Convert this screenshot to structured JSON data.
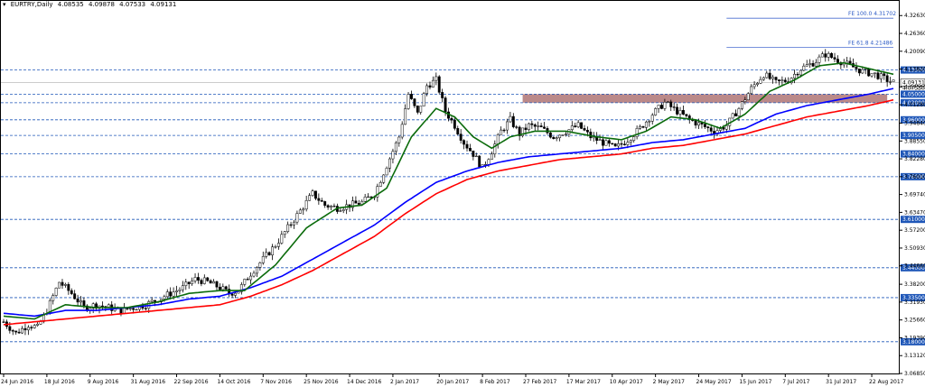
{
  "header": {
    "symbol": "EURTRY,Daily",
    "open": "4.08535",
    "high": "4.09878",
    "low": "4.07533",
    "close": "4.09131"
  },
  "colors": {
    "background": "#ffffff",
    "candle": "#000000",
    "ma_fast": "#0b6b0b",
    "ma_mid": "#0000ff",
    "ma_slow": "#ff0000",
    "level_line": "#1f57b8",
    "level_badge": "#1f57b8",
    "zone": "#b47c7c",
    "price_badge": "#ffffff"
  },
  "chart_data": {
    "type": "candlestick",
    "symbol": "EURTRY",
    "timeframe": "Daily",
    "ylim": [
      3.0685,
      4.3683
    ],
    "y_ticks": [
      "4.32630",
      "4.26360",
      "4.20090",
      "4.13820",
      "4.07550",
      "4.01280",
      "3.94840",
      "3.88550",
      "3.82280",
      "3.76010",
      "3.69740",
      "3.63470",
      "3.57200",
      "3.50930",
      "3.44660",
      "3.38200",
      "3.31930",
      "3.25660",
      "3.19390",
      "3.13120",
      "3.06850"
    ],
    "x_ticks": [
      "24 Jun 2016",
      "18 Jul 2016",
      "9 Aug 2016",
      "31 Aug 2016",
      "22 Sep 2016",
      "14 Oct 2016",
      "7 Nov 2016",
      "25 Nov 2016",
      "14 Dec 2016",
      "2 Jan 2017",
      "20 Jan 2017",
      "8 Feb 2017",
      "27 Feb 2017",
      "17 Mar 2017",
      "10 Apr 2017",
      "2 May 2017",
      "24 May 2017",
      "15 Jun 2017",
      "7 Jul 2017",
      "31 Jul 2017",
      "22 Aug 2017"
    ],
    "horizontal_levels": [
      "4.13500",
      "4.05000",
      "4.02000",
      "3.96000",
      "3.90500",
      "3.84000",
      "3.76000",
      "3.61000",
      "3.44000",
      "3.33500",
      "3.18000"
    ],
    "current_price": "4.09131",
    "current_price_value": 4.09131,
    "extra_price_label": "4.07530",
    "fibonacci": [
      {
        "label": "FE 100.0 4.31702",
        "value": 4.31702
      },
      {
        "label": "FE 61.8 4.21486",
        "value": 4.21486
      }
    ],
    "zone": {
      "from": 4.02,
      "to": 4.05
    },
    "price_path": [
      [
        0,
        3.25
      ],
      [
        4,
        3.21
      ],
      [
        8,
        3.24
      ],
      [
        11,
        3.23
      ],
      [
        14,
        3.29
      ],
      [
        18,
        3.39
      ],
      [
        22,
        3.35
      ],
      [
        26,
        3.3
      ],
      [
        30,
        3.31
      ],
      [
        34,
        3.3
      ],
      [
        38,
        3.29
      ],
      [
        42,
        3.3
      ],
      [
        46,
        3.31
      ],
      [
        50,
        3.33
      ],
      [
        54,
        3.35
      ],
      [
        58,
        3.37
      ],
      [
        62,
        3.4
      ],
      [
        66,
        3.39
      ],
      [
        70,
        3.37
      ],
      [
        73,
        3.35
      ],
      [
        76,
        3.36
      ],
      [
        80,
        3.42
      ],
      [
        84,
        3.47
      ],
      [
        88,
        3.52
      ],
      [
        92,
        3.58
      ],
      [
        96,
        3.64
      ],
      [
        100,
        3.7
      ],
      [
        104,
        3.66
      ],
      [
        108,
        3.65
      ],
      [
        112,
        3.66
      ],
      [
        116,
        3.67
      ],
      [
        120,
        3.7
      ],
      [
        124,
        3.8
      ],
      [
        128,
        3.9
      ],
      [
        131,
        4.05
      ],
      [
        134,
        3.98
      ],
      [
        137,
        4.08
      ],
      [
        140,
        4.1
      ],
      [
        143,
        3.99
      ],
      [
        146,
        3.94
      ],
      [
        149,
        3.88
      ],
      [
        152,
        3.84
      ],
      [
        155,
        3.79
      ],
      [
        158,
        3.85
      ],
      [
        161,
        3.92
      ],
      [
        164,
        3.96
      ],
      [
        167,
        3.91
      ],
      [
        170,
        3.94
      ],
      [
        174,
        3.93
      ],
      [
        178,
        3.9
      ],
      [
        182,
        3.92
      ],
      [
        186,
        3.94
      ],
      [
        190,
        3.9
      ],
      [
        194,
        3.88
      ],
      [
        198,
        3.86
      ],
      [
        202,
        3.89
      ],
      [
        206,
        3.93
      ],
      [
        210,
        3.98
      ],
      [
        214,
        4.02
      ],
      [
        218,
        3.99
      ],
      [
        222,
        3.96
      ],
      [
        226,
        3.94
      ],
      [
        230,
        3.92
      ],
      [
        234,
        3.94
      ],
      [
        238,
        4.0
      ],
      [
        242,
        4.07
      ],
      [
        246,
        4.12
      ],
      [
        250,
        4.09
      ],
      [
        254,
        4.1
      ],
      [
        258,
        4.14
      ],
      [
        262,
        4.16
      ],
      [
        266,
        4.19
      ],
      [
        270,
        4.17
      ],
      [
        274,
        4.15
      ],
      [
        278,
        4.13
      ],
      [
        282,
        4.12
      ],
      [
        286,
        4.1
      ],
      [
        288,
        4.09131
      ]
    ],
    "ma_fast_path": [
      [
        0,
        3.27
      ],
      [
        10,
        3.26
      ],
      [
        20,
        3.31
      ],
      [
        30,
        3.3
      ],
      [
        40,
        3.3
      ],
      [
        50,
        3.32
      ],
      [
        60,
        3.35
      ],
      [
        70,
        3.36
      ],
      [
        78,
        3.36
      ],
      [
        88,
        3.45
      ],
      [
        98,
        3.58
      ],
      [
        108,
        3.65
      ],
      [
        116,
        3.66
      ],
      [
        124,
        3.72
      ],
      [
        132,
        3.9
      ],
      [
        140,
        4.0
      ],
      [
        146,
        3.97
      ],
      [
        152,
        3.9
      ],
      [
        158,
        3.86
      ],
      [
        164,
        3.9
      ],
      [
        172,
        3.92
      ],
      [
        182,
        3.92
      ],
      [
        192,
        3.9
      ],
      [
        200,
        3.89
      ],
      [
        208,
        3.92
      ],
      [
        216,
        3.97
      ],
      [
        224,
        3.96
      ],
      [
        232,
        3.93
      ],
      [
        240,
        3.98
      ],
      [
        248,
        4.06
      ],
      [
        256,
        4.1
      ],
      [
        264,
        4.15
      ],
      [
        272,
        4.16
      ],
      [
        280,
        4.14
      ],
      [
        288,
        4.12
      ]
    ],
    "ma_mid_path": [
      [
        0,
        3.28
      ],
      [
        10,
        3.27
      ],
      [
        20,
        3.29
      ],
      [
        30,
        3.29
      ],
      [
        40,
        3.3
      ],
      [
        50,
        3.31
      ],
      [
        60,
        3.33
      ],
      [
        70,
        3.34
      ],
      [
        80,
        3.37
      ],
      [
        90,
        3.41
      ],
      [
        100,
        3.47
      ],
      [
        110,
        3.53
      ],
      [
        120,
        3.59
      ],
      [
        130,
        3.67
      ],
      [
        140,
        3.74
      ],
      [
        150,
        3.78
      ],
      [
        160,
        3.81
      ],
      [
        170,
        3.83
      ],
      [
        180,
        3.84
      ],
      [
        190,
        3.85
      ],
      [
        200,
        3.86
      ],
      [
        210,
        3.88
      ],
      [
        220,
        3.89
      ],
      [
        230,
        3.91
      ],
      [
        240,
        3.93
      ],
      [
        250,
        3.98
      ],
      [
        260,
        4.01
      ],
      [
        270,
        4.03
      ],
      [
        280,
        4.05
      ],
      [
        288,
        4.07
      ]
    ],
    "ma_slow_path": [
      [
        0,
        3.24
      ],
      [
        10,
        3.25
      ],
      [
        20,
        3.26
      ],
      [
        30,
        3.27
      ],
      [
        40,
        3.28
      ],
      [
        50,
        3.29
      ],
      [
        60,
        3.3
      ],
      [
        70,
        3.31
      ],
      [
        80,
        3.34
      ],
      [
        90,
        3.38
      ],
      [
        100,
        3.43
      ],
      [
        110,
        3.49
      ],
      [
        120,
        3.55
      ],
      [
        130,
        3.63
      ],
      [
        140,
        3.7
      ],
      [
        150,
        3.75
      ],
      [
        160,
        3.78
      ],
      [
        170,
        3.8
      ],
      [
        180,
        3.82
      ],
      [
        190,
        3.83
      ],
      [
        200,
        3.84
      ],
      [
        210,
        3.86
      ],
      [
        220,
        3.87
      ],
      [
        230,
        3.89
      ],
      [
        240,
        3.91
      ],
      [
        250,
        3.94
      ],
      [
        260,
        3.97
      ],
      [
        270,
        3.99
      ],
      [
        280,
        4.01
      ],
      [
        288,
        4.03
      ]
    ]
  }
}
